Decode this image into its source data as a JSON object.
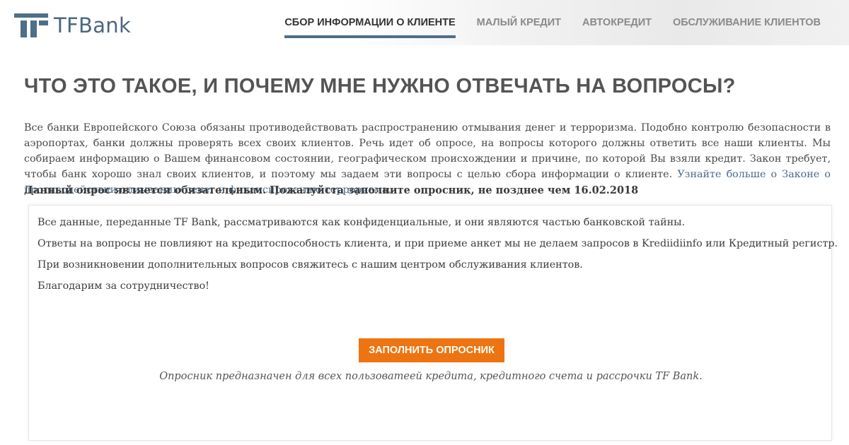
{
  "header": {
    "logo_text": "TFBank",
    "nav": [
      {
        "label": "Сбор информации о клиенте",
        "active": true
      },
      {
        "label": "Малый кредит",
        "active": false
      },
      {
        "label": "Автокредит",
        "active": false
      },
      {
        "label": "Обслуживание клиентов",
        "active": false
      }
    ]
  },
  "main": {
    "title": "Что это такое, и почему мне нужно отвечать на вопросы?",
    "intro_text": "Все банки Европейского Союза обязаны противодействовать распространению отмывания денег и терроризма. Подобно контролю безопасности в аэропортах, банки должны проверять всех своих клиентов. Речь идет об опросе, на вопросы которого должны ответить все наши клиенты. Мы собираем информацию о Вашем финансовом состоянии, географическом происхождении и причине, по которой Вы взяли кредит. Закон требует, чтобы банк хорошо знал своих клиентов, и поэтому мы задаем эти вопросы с целью сбора информации о клиенте. ",
    "intro_link": "Узнайте больше о Законе о противодействии отмыванию денег и финансированию терроризма.",
    "notice": "Данный опрос является обязательным. Пожалуйста заполните опросник, не позднее чем 16.02.2018"
  },
  "panel": {
    "paragraphs": [
      "Все данные, переданные TF Bank, рассматриваются как конфиденциальные, и они являются частью банковской тайны.",
      "Ответы на вопросы не повлияют на кредитоспособность клиента, и при приеме анкет мы не делаем запросов в Krediidiinfo или Кредитный регистр.",
      "При возникновении дополнительных вопросов свяжитесь с нашим центром обслуживания клиентов.",
      "Благодарим за сотрудничество!"
    ],
    "cta_label": "Заполнить опросник",
    "caption": "Опросник предназначен для всех пользоватеей кредита, кредитного счета и рассрочки TF Bank."
  },
  "colors": {
    "brand": "#4f6e87",
    "accent": "#ed7410",
    "link": "#4b6b86"
  }
}
